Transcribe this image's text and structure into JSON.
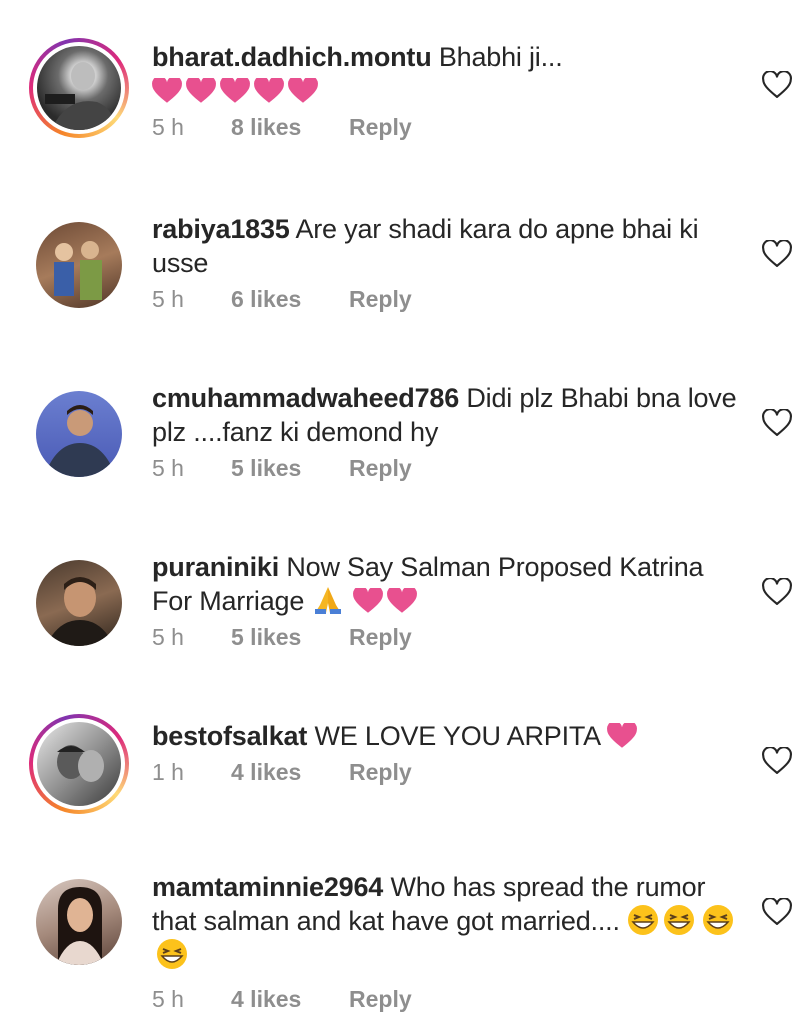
{
  "comments": [
    {
      "username": "bharat.dadhich.montu",
      "text": "Bhabhi ji...",
      "time": "5 h",
      "likes": "8 likes",
      "reply": "Reply",
      "story": true
    },
    {
      "username": "rabiya1835",
      "text": "Are yar shadi kara do apne bhai ki usse",
      "time": "5 h",
      "likes": "6 likes",
      "reply": "Reply",
      "story": false
    },
    {
      "username": "cmuhammadwaheed786",
      "text": "Didi plz Bhabi bna love plz ....fanz ki demond hy",
      "time": "5 h",
      "likes": "5 likes",
      "reply": "Reply",
      "story": false
    },
    {
      "username": "puraniniki",
      "text": "Now Say Salman Proposed Katrina For Marriage",
      "time": "5 h",
      "likes": "5 likes",
      "reply": "Reply",
      "story": false
    },
    {
      "username": "bestofsalkat",
      "text": "WE LOVE YOU ARPITA",
      "time": "1 h",
      "likes": "4 likes",
      "reply": "Reply",
      "story": true
    },
    {
      "username": "mamtaminnie2964",
      "text": "Who has spread the rumor that salman and kat have got  married....",
      "time": "5 h",
      "likes": "4 likes",
      "reply": "Reply",
      "story": false
    }
  ],
  "icons": {
    "like": "heart-outline-icon",
    "emoji_heart": "pink-heart-emoji",
    "emoji_pray": "folded-hands-emoji",
    "emoji_grin": "grinning-squinting-emoji"
  },
  "colors": {
    "emoji_heart": "#e8508f",
    "meta": "#8e8e8e",
    "username": "#262626"
  }
}
